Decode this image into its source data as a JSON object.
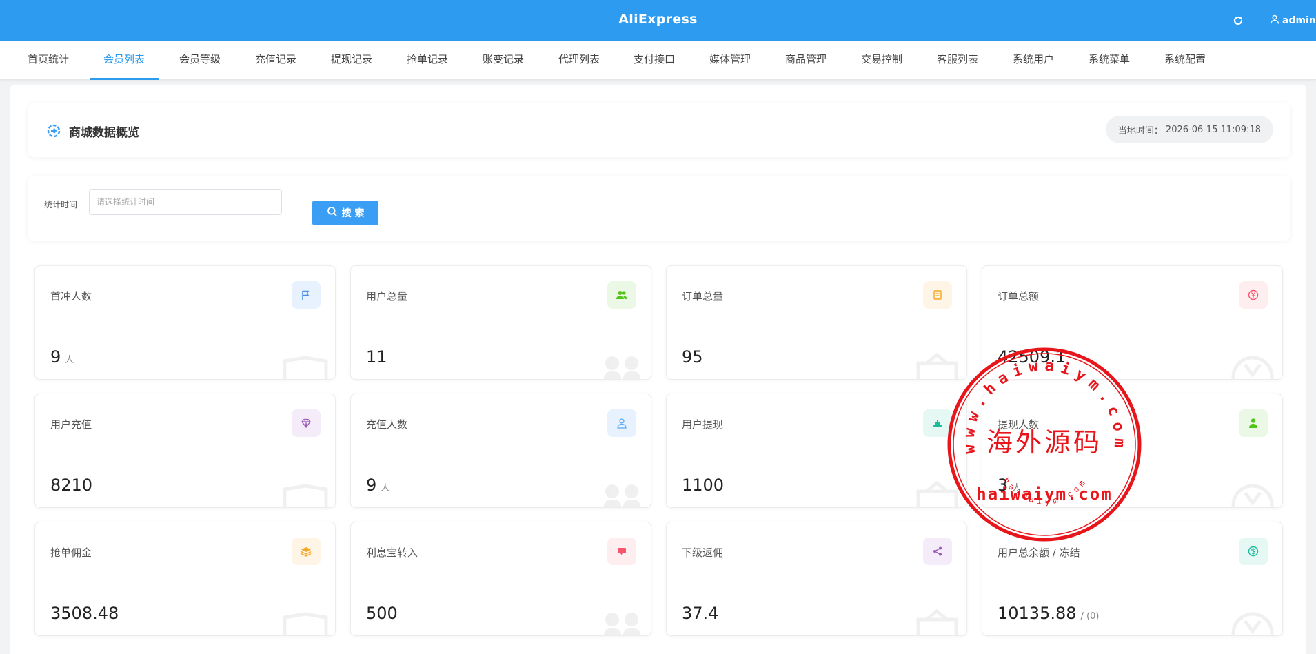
{
  "header": {
    "title": "AliExpress",
    "refresh_icon": "refresh-icon",
    "user_icon": "user-icon",
    "username": "admin"
  },
  "nav": {
    "active_index": 1,
    "tabs": [
      {
        "label": "首页统计"
      },
      {
        "label": "会员列表"
      },
      {
        "label": "会员等级"
      },
      {
        "label": "充值记录"
      },
      {
        "label": "提现记录"
      },
      {
        "label": "抢单记录"
      },
      {
        "label": "账变记录"
      },
      {
        "label": "代理列表"
      },
      {
        "label": "支付接口"
      },
      {
        "label": "媒体管理"
      },
      {
        "label": "商品管理"
      },
      {
        "label": "交易控制"
      },
      {
        "label": "客服列表"
      },
      {
        "label": "系统用户"
      },
      {
        "label": "系统菜单"
      },
      {
        "label": "系统配置"
      }
    ]
  },
  "overview": {
    "title": "商城数据概览",
    "time_label": "当地时间：",
    "time_value": "2026-06-15 11:09:18"
  },
  "filter": {
    "label": "统计时间",
    "placeholder": "请选择统计时间",
    "search_label": "搜 索"
  },
  "cards": [
    {
      "label": "首冲人数",
      "value": "9",
      "unit": "人",
      "icon": "flag-icon",
      "color": "#4a90e2",
      "bg": "#e8f2fe"
    },
    {
      "label": "用户总量",
      "value": "11",
      "unit": "",
      "icon": "users-icon",
      "color": "#52c41a",
      "bg": "#ecf8e6"
    },
    {
      "label": "订单总量",
      "value": "95",
      "unit": "",
      "icon": "document-icon",
      "color": "#f5a623",
      "bg": "#fef5e6"
    },
    {
      "label": "订单总额",
      "value": "42509.1",
      "unit": "",
      "icon": "yen-icon",
      "color": "#f5566b",
      "bg": "#feeef0"
    },
    {
      "label": "用户充值",
      "value": "8210",
      "unit": "",
      "icon": "diamond-icon",
      "color": "#9b59b6",
      "bg": "#f4ecf8"
    },
    {
      "label": "充值人数",
      "value": "9",
      "unit": "人",
      "icon": "user-outline-icon",
      "color": "#5aa9f0",
      "bg": "#e8f2fe"
    },
    {
      "label": "用户提现",
      "value": "1100",
      "unit": "",
      "icon": "ship-icon",
      "color": "#1abc9c",
      "bg": "#e6f8f4"
    },
    {
      "label": "提现人数",
      "value": "3",
      "unit": "人",
      "icon": "person-icon",
      "color": "#52c41a",
      "bg": "#ecf8e6"
    },
    {
      "label": "抢单佣金",
      "value": "3508.48",
      "unit": "",
      "icon": "layers-icon",
      "color": "#f5a623",
      "bg": "#fef5e6"
    },
    {
      "label": "利息宝转入",
      "value": "500",
      "unit": "",
      "icon": "chat-icon",
      "color": "#f5566b",
      "bg": "#feeef0"
    },
    {
      "label": "下级返佣",
      "value": "37.4",
      "unit": "",
      "icon": "share-icon",
      "color": "#9b59b6",
      "bg": "#f4ecf8"
    },
    {
      "label": "用户总余额 / 冻结",
      "value": "10135.88",
      "unit": "/ (0)",
      "icon": "dollar-icon",
      "color": "#1abc9c",
      "bg": "#e6f8f4"
    }
  ],
  "stamp": {
    "top_text": "www.haiwaiym.com",
    "center_text": "海外源码",
    "bottom_text": "haiwaiym.com",
    "small_text": "haiwaiym.com",
    "color": "#e8151b"
  }
}
